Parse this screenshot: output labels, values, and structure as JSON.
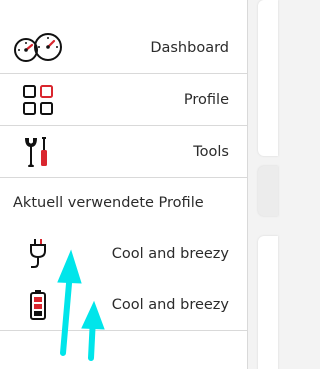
{
  "sidebar": {
    "menu": [
      {
        "label": "Dashboard",
        "icon": "gauges-icon"
      },
      {
        "label": "Profile",
        "icon": "grid-icon"
      },
      {
        "label": "Tools",
        "icon": "tools-icon"
      }
    ],
    "section_title": "Aktuell verwendete Profile",
    "profiles": [
      {
        "label": "Cool and breezy",
        "icon": "power-plug-icon"
      },
      {
        "label": "Cool and breezy",
        "icon": "battery-icon"
      }
    ]
  },
  "colors": {
    "accent": "#d9262e",
    "text": "#2b2b2b",
    "divider": "#d9d9d9",
    "annotation_arrow": "#00e5ea"
  }
}
